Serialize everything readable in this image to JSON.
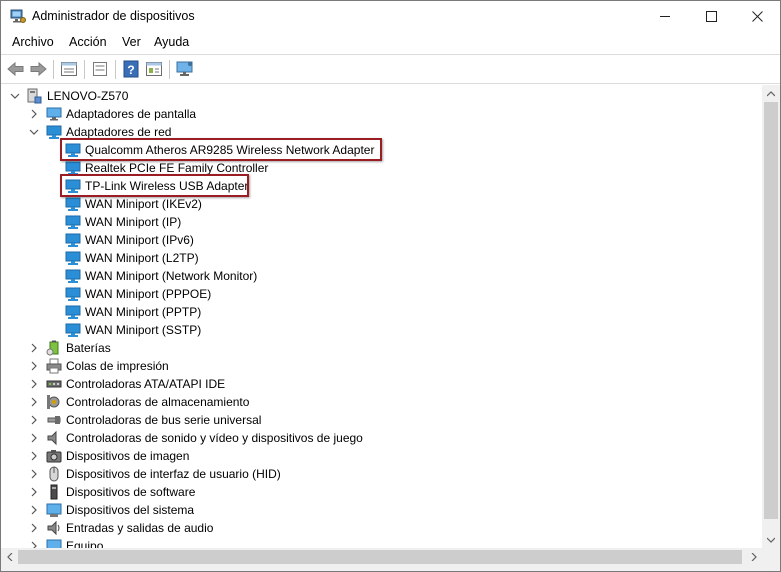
{
  "window": {
    "title": "Administrador de dispositivos",
    "controls": [
      "minimize",
      "maximize",
      "close"
    ]
  },
  "menu": {
    "items": [
      "Archivo",
      "Acción",
      "Ver",
      "Ayuda"
    ]
  },
  "toolbar": {
    "buttons": [
      "back-icon",
      "forward-icon",
      "properties-icon",
      "show-hide-icon",
      "help-icon",
      "action-view-icon",
      "monitor-icon"
    ]
  },
  "tree": {
    "root": "LENOVO-Z570",
    "display_adapters": "Adaptadores de pantalla",
    "network_adapters": "Adaptadores de red",
    "network_children": [
      "Qualcomm Atheros AR9285 Wireless Network Adapter",
      "Realtek PCIe FE Family Controller",
      "TP-Link Wireless USB Adapter",
      "WAN Miniport (IKEv2)",
      "WAN Miniport (IP)",
      "WAN Miniport (IPv6)",
      "WAN Miniport (L2TP)",
      "WAN Miniport (Network Monitor)",
      "WAN Miniport (PPPOE)",
      "WAN Miniport (PPTP)",
      "WAN Miniport (SSTP)"
    ],
    "categories": [
      "Baterías",
      "Colas de impresión",
      "Controladoras ATA/ATAPI IDE",
      "Controladoras de almacenamiento",
      "Controladoras de bus serie universal",
      "Controladoras de sonido y vídeo y dispositivos de juego",
      "Dispositivos de imagen",
      "Dispositivos de interfaz de usuario (HID)",
      "Dispositivos de software",
      "Dispositivos del sistema",
      "Entradas y salidas de audio",
      "Equipo"
    ],
    "highlighted": [
      "Qualcomm Atheros AR9285 Wireless Network Adapter",
      "TP-Link Wireless USB Adapter"
    ]
  },
  "colors": {
    "highlight_border": "#9b1c22",
    "network_icon": "#2a8fd6"
  }
}
